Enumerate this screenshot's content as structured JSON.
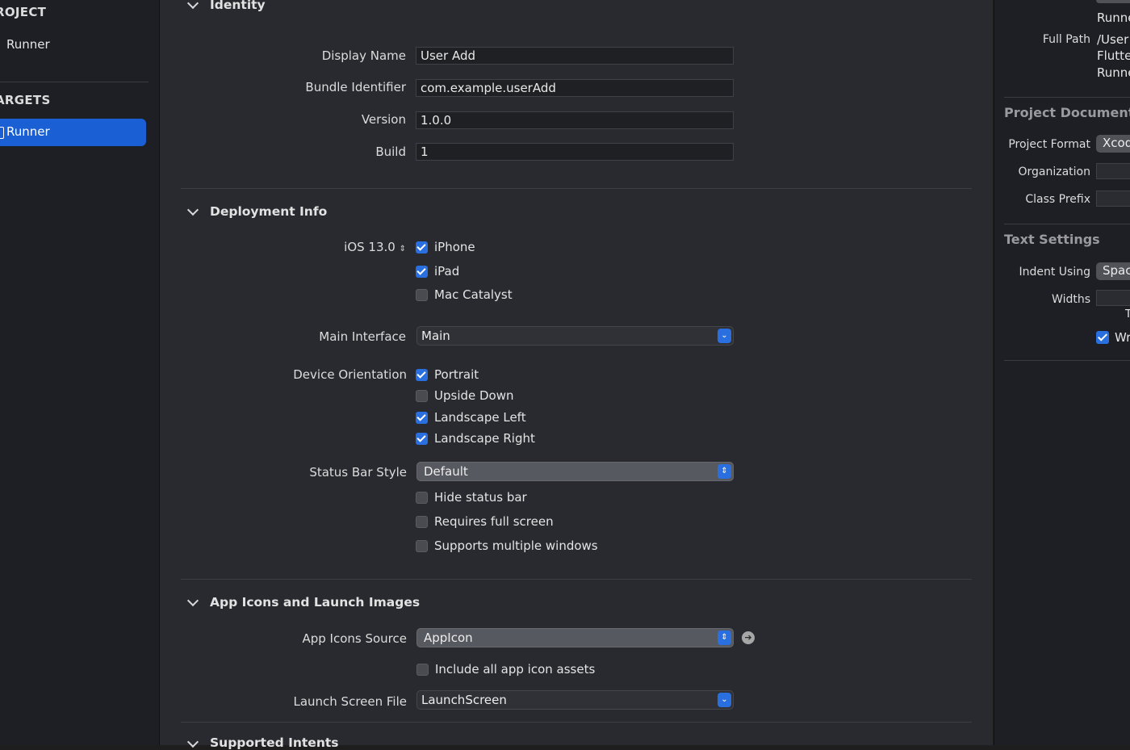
{
  "navigator": {
    "project_heading": "ROJECT",
    "project_item": "Runner",
    "targets_heading": "ARGETS",
    "target_item": "Runner"
  },
  "identity": {
    "title": "Identity",
    "display_name_label": "Display Name",
    "display_name": "User Add",
    "bundle_id_label": "Bundle Identifier",
    "bundle_id": "com.example.userAdd",
    "version_label": "Version",
    "version": "1.0.0",
    "build_label": "Build",
    "build": "1"
  },
  "deployment": {
    "title": "Deployment Info",
    "ios_label": "iOS 13.0",
    "devices": [
      {
        "label": "iPhone",
        "checked": true
      },
      {
        "label": "iPad",
        "checked": true
      },
      {
        "label": "Mac Catalyst",
        "checked": false
      }
    ],
    "main_interface_label": "Main Interface",
    "main_interface": "Main",
    "orientation_label": "Device Orientation",
    "orientations": [
      {
        "label": "Portrait",
        "checked": true
      },
      {
        "label": "Upside Down",
        "checked": false
      },
      {
        "label": "Landscape Left",
        "checked": true
      },
      {
        "label": "Landscape Right",
        "checked": true
      }
    ],
    "status_bar_label": "Status Bar Style",
    "status_bar": "Default",
    "status_options": [
      {
        "label": "Hide status bar",
        "checked": false
      },
      {
        "label": "Requires full screen",
        "checked": false
      },
      {
        "label": "Supports multiple windows",
        "checked": false
      }
    ]
  },
  "app_icons": {
    "title": "App Icons and Launch Images",
    "source_label": "App Icons Source",
    "source": "AppIcon",
    "include_all_label": "Include all app icon assets",
    "include_all_checked": false,
    "launch_label": "Launch Screen File",
    "launch": "LaunchScreen"
  },
  "supported_intents": {
    "title": "Supported Intents"
  },
  "inspector": {
    "location_value": "Runne",
    "full_path_label": "Full Path",
    "full_path_lines": [
      "/User",
      "Flutte",
      "Runne"
    ],
    "project_document_title": "Project Document",
    "project_format_label": "Project Format",
    "project_format": "Xcod",
    "organization_label": "Organization",
    "class_prefix_label": "Class Prefix",
    "text_settings_title": "Text Settings",
    "indent_using_label": "Indent Using",
    "indent_using": "Spac",
    "widths_label": "Widths",
    "tab_label": "T",
    "wrap_label": "Wr"
  },
  "colors": {
    "accent": "#2a6fe0",
    "selection": "#1a5fd3",
    "editor_bg": "#292a2f",
    "sidebar_bg": "#1e1f24"
  }
}
